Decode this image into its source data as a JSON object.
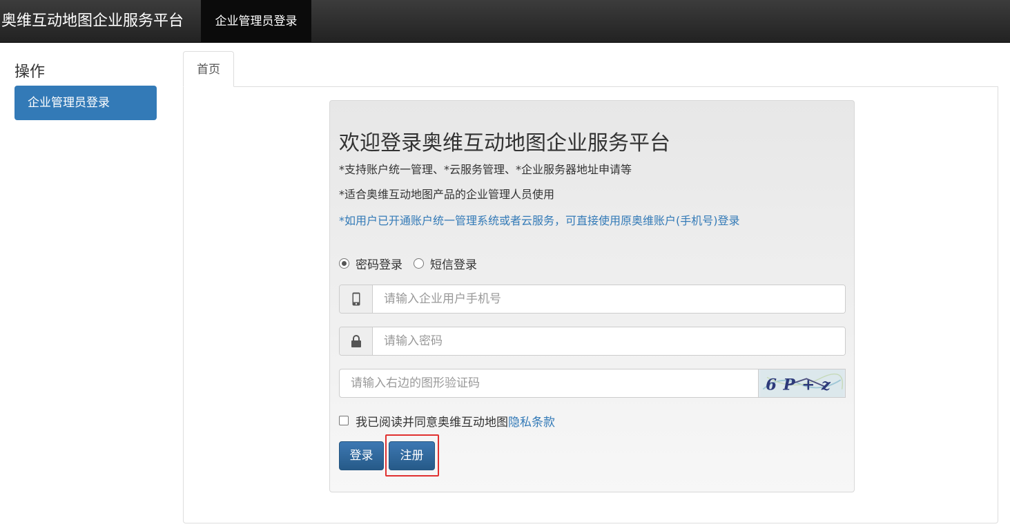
{
  "navbar": {
    "brand": "奥维互动地图企业服务平台",
    "active_item": "企业管理员登录"
  },
  "sidebar": {
    "title": "操作",
    "items": [
      {
        "label": "企业管理员登录"
      }
    ]
  },
  "tabs": [
    {
      "label": "首页"
    }
  ],
  "login": {
    "heading": "欢迎登录奥维互动地图企业服务平台",
    "notes": [
      "*支持账户统一管理、*云服务管理、*企业服务器地址申请等",
      "*适合奥维互动地图产品的企业管理人员使用",
      "*如用户已开通账户统一管理系统或者云服务，可直接使用原奥维账户(手机号)登录"
    ],
    "modes": [
      {
        "label": "密码登录",
        "checked": true
      },
      {
        "label": "短信登录",
        "checked": false
      }
    ],
    "phone_placeholder": "请输入企业用户手机号",
    "password_placeholder": "请输入密码",
    "captcha_placeholder": "请输入右边的图形验证码",
    "captcha_text": "6P+z",
    "agree_text": "我已阅读并同意奥维互动地图",
    "privacy_link": "隐私条款",
    "login_button": "登录",
    "register_button": "注册"
  },
  "icons": {
    "phone": "mobile-phone-icon",
    "password": "lock-icon"
  },
  "colors": {
    "primary": "#337ab7",
    "navbar": "#222222",
    "highlight": "#e0302f"
  }
}
